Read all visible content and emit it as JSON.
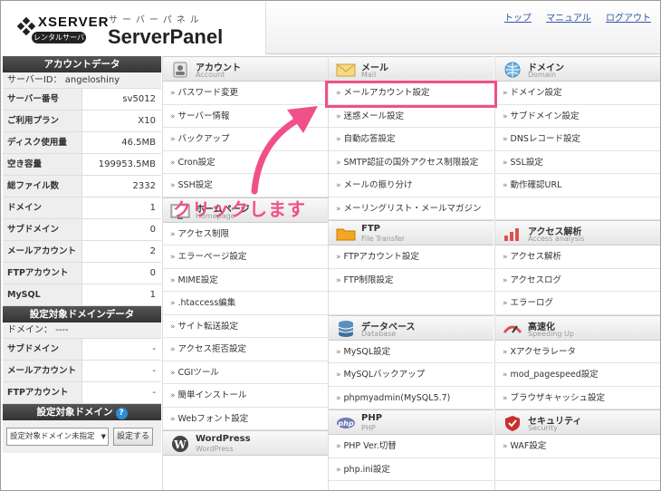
{
  "header": {
    "brand": "XSERVER",
    "badge": "レンタルサーバー",
    "sub": "サーバーパネル",
    "title": "ServerPanel",
    "links": [
      "トップ",
      "マニュアル",
      "ログアウト"
    ]
  },
  "account": {
    "title": "アカウントデータ",
    "server_id": "サーバーID： angeloshiny",
    "rows": [
      [
        "サーバー番号",
        "sv5012"
      ],
      [
        "ご利用プラン",
        "X10"
      ],
      [
        "ディスク使用量",
        "46.5MB"
      ],
      [
        "空き容量",
        "199953.5MB"
      ],
      [
        "総ファイル数",
        "2332"
      ],
      [
        "ドメイン",
        "1"
      ],
      [
        "サブドメイン",
        "0"
      ],
      [
        "メールアカウント",
        "2"
      ],
      [
        "FTPアカウント",
        "0"
      ],
      [
        "MySQL",
        "1"
      ]
    ]
  },
  "domain_data": {
    "title": "設定対象ドメインデータ",
    "domain": "ドメイン： ----",
    "rows": [
      [
        "サブドメイン",
        "-"
      ],
      [
        "メールアカウント",
        "-"
      ],
      [
        "FTPアカウント",
        "-"
      ]
    ]
  },
  "domain_select": {
    "title": "設定対象ドメイン",
    "help": "?",
    "value": "設定対象ドメイン未指定",
    "button": "設定する"
  },
  "col1": [
    {
      "t1": "アカウント",
      "t2": "Account",
      "icon": "account-icon",
      "items": [
        "パスワード変更",
        "サーバー情報",
        "バックアップ",
        "Cron設定",
        "SSH設定"
      ]
    },
    {
      "t1": "ホームページ",
      "t2": "Homepage",
      "icon": "homepage-icon",
      "items": [
        "アクセス制限",
        "エラーページ設定",
        "MIME設定",
        ".htaccess編集",
        "サイト転送設定",
        "アクセス拒否設定",
        "CGIツール",
        "簡単インストール",
        "Webフォント設定"
      ]
    },
    {
      "t1": "WordPress",
      "t2": "WordPress",
      "icon": "wordpress-icon",
      "items": []
    }
  ],
  "col2": [
    {
      "t1": "メール",
      "t2": "Mail",
      "icon": "mail-icon",
      "items": [
        "メールアカウント設定",
        "迷惑メール設定",
        "自動応答設定",
        "SMTP認証の国外アクセス制限設定",
        "メールの振り分け",
        "メーリングリスト・メールマガジン"
      ]
    },
    {
      "t1": "FTP",
      "t2": "File Transfer",
      "icon": "ftp-folder-icon",
      "items": [
        "FTPアカウント設定",
        "FTP制限設定",
        ""
      ]
    },
    {
      "t1": "データベース",
      "t2": "Database",
      "icon": "database-icon",
      "items": [
        "MySQL設定",
        "MySQLバックアップ",
        "phpmyadmin(MySQL5.7)"
      ]
    },
    {
      "t1": "PHP",
      "t2": "PHP",
      "icon": "php-icon",
      "items": [
        "PHP Ver.切替",
        "php.ini設定"
      ]
    }
  ],
  "col3": [
    {
      "t1": "ドメイン",
      "t2": "Domain",
      "icon": "globe-icon",
      "items": [
        "ドメイン設定",
        "サブドメイン設定",
        "DNSレコード設定",
        "SSL設定",
        "動作確認URL",
        ""
      ]
    },
    {
      "t1": "アクセス解析",
      "t2": "Access analysis",
      "icon": "access-analysis-icon",
      "items": [
        "アクセス解析",
        "アクセスログ",
        "エラーログ"
      ]
    },
    {
      "t1": "高速化",
      "t2": "Speeding Up",
      "icon": "speedup-icon",
      "items": [
        "Xアクセラレータ",
        "mod_pagespeed設定",
        "ブラウザキャッシュ設定"
      ]
    },
    {
      "t1": "セキュリティ",
      "t2": "Security",
      "icon": "security-icon",
      "items": [
        "WAF設定",
        ""
      ]
    }
  ],
  "annotation": "クリックします",
  "colors": {
    "accent": "#f0508a",
    "link": "#3355aa"
  }
}
